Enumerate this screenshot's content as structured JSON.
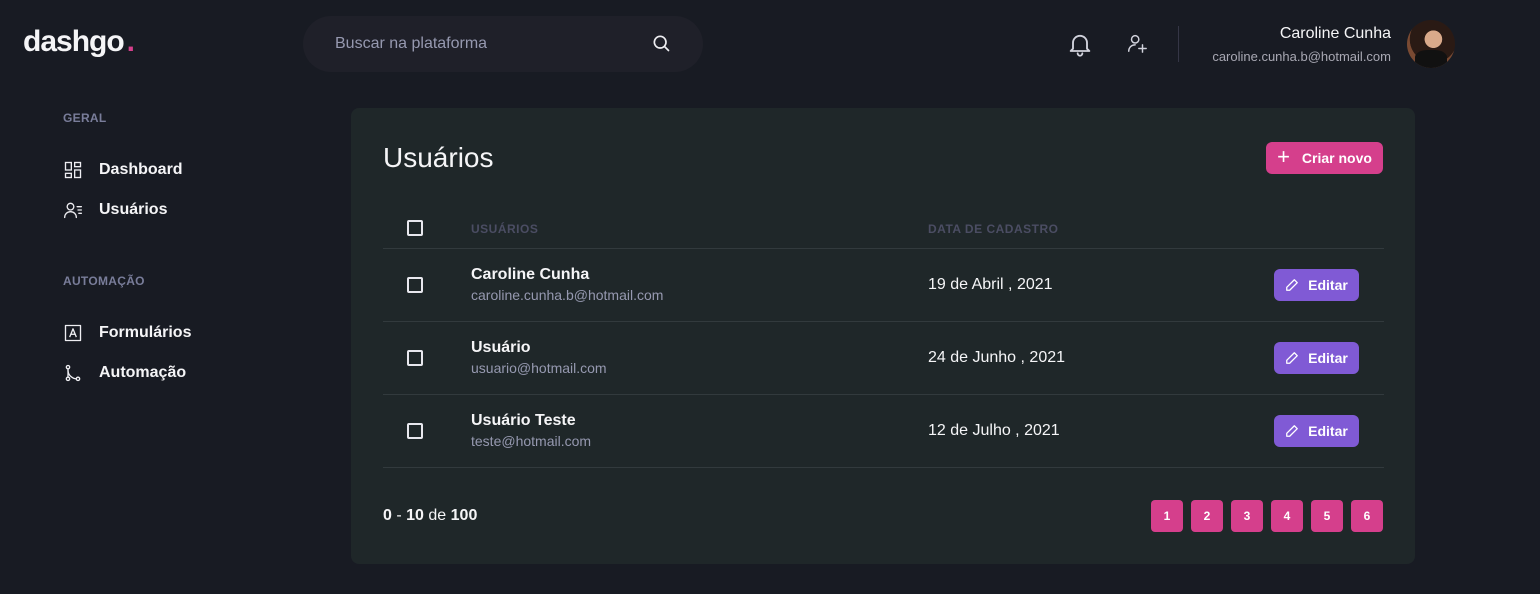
{
  "brand": {
    "name": "dashgo",
    "dot": ".",
    "accent": "#d53f8c"
  },
  "search": {
    "placeholder": "Buscar na plataforma",
    "icon": "search-icon"
  },
  "header_icons": [
    "bell-icon",
    "add-user-icon"
  ],
  "profile": {
    "name": "Caroline Cunha",
    "email": "caroline.cunha.b@hotmail.com"
  },
  "sidebar": {
    "sections": [
      {
        "title": "GERAL",
        "items": [
          {
            "label": "Dashboard",
            "icon": "dashboard-icon"
          },
          {
            "label": "Usuários",
            "icon": "users-icon"
          }
        ]
      },
      {
        "title": "AUTOMAÇÃO",
        "items": [
          {
            "label": "Formulários",
            "icon": "form-icon"
          },
          {
            "label": "Automação",
            "icon": "git-merge-icon"
          }
        ]
      }
    ]
  },
  "main": {
    "title": "Usuários",
    "create_button": "Criar novo",
    "columns": [
      "USUÁRIOS",
      "DATA DE CADASTRO"
    ],
    "edit_label": "Editar",
    "rows": [
      {
        "name": "Caroline Cunha",
        "email": "caroline.cunha.b@hotmail.com",
        "date": "19 de Abril , 2021"
      },
      {
        "name": "Usuário",
        "email": "usuario@hotmail.com",
        "date": "24 de Junho , 2021"
      },
      {
        "name": "Usuário Teste",
        "email": "teste@hotmail.com",
        "date": "12 de Julho , 2021"
      }
    ],
    "pagination": {
      "from": "0",
      "sep": "-",
      "to": "10",
      "of": "de",
      "total": "100",
      "pages": [
        "1",
        "2",
        "3",
        "4",
        "5",
        "6"
      ]
    }
  },
  "colors": {
    "background": "#181b23",
    "panel": "#1f2729",
    "pink": "#d53f8c",
    "purple": "#805ad5"
  }
}
